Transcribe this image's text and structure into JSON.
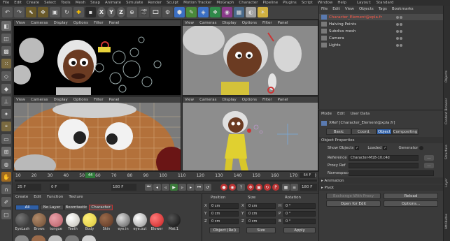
{
  "menubar": {
    "items": [
      "File",
      "Edit",
      "Create",
      "Select",
      "Tools",
      "Mesh",
      "Snap",
      "Animate",
      "Simulate",
      "Render",
      "Sculpt",
      "Motion Tracker",
      "MoGraph",
      "Character",
      "Pipeline",
      "Plugins",
      "Script",
      "Window",
      "Help"
    ],
    "right_text": "Layout:",
    "right_value": "Standard"
  },
  "toolbar": {
    "x": "X",
    "y": "Y",
    "z": "Z"
  },
  "viewports": {
    "top_left": {
      "menu": [
        "View",
        "Cameras",
        "Display",
        "Options",
        "Filter",
        "Panel"
      ]
    },
    "top_right": {
      "menu": [
        "View",
        "Cameras",
        "Display",
        "Options",
        "Filter",
        "Panel"
      ]
    },
    "bottom_left": {
      "menu": [
        "View",
        "Cameras",
        "Display",
        "Options",
        "Filter",
        "Panel"
      ]
    },
    "bottom_right": {
      "menu": [
        "View",
        "Cameras",
        "Display",
        "Options",
        "Filter",
        "Panel"
      ]
    }
  },
  "timeline": {
    "ticks": [
      "10",
      "20",
      "30",
      "40",
      "50",
      "60",
      "70",
      "80",
      "90",
      "100",
      "110",
      "120",
      "130",
      "140",
      "150",
      "160",
      "170",
      "180"
    ],
    "current_frame": "44",
    "frame_badge": "64 F",
    "start": "25 F",
    "preview_start": "0 F",
    "preview_end": "180 F",
    "end": "180 F"
  },
  "material_manager": {
    "menu": [
      "Create",
      "Edit",
      "Function",
      "Texture"
    ],
    "filters": [
      "All",
      "No Layer",
      "Boomtastic",
      "Character"
    ],
    "materials": [
      {
        "label": "EyeLash",
        "color": "#2a2a2a"
      },
      {
        "label": "Brows",
        "color": "#6b4a32"
      },
      {
        "label": "tongue",
        "color": "#b45a62"
      },
      {
        "label": "Teeth",
        "color": "#e8e6df"
      },
      {
        "label": "Body",
        "color": "#d9c53a"
      },
      {
        "label": "Skin",
        "color": "#5a3422"
      },
      {
        "label": "eye.in",
        "color": "#8a8a8a"
      },
      {
        "label": "eye.out",
        "color": "#bdbdbd"
      },
      {
        "label": "Blower",
        "color": "#c81f1f"
      },
      {
        "label": "Mat.1",
        "color": "#0e0e0e"
      }
    ]
  },
  "coord_manager": {
    "headers": [
      "Position",
      "Size",
      "Rotation"
    ],
    "rows": [
      {
        "axis": "X",
        "pos": "0 cm",
        "sizeaxis": "X",
        "size": "0 cm",
        "rotaxis": "H",
        "rot": "0 °"
      },
      {
        "axis": "Y",
        "pos": "0 cm",
        "sizeaxis": "Y",
        "size": "0 cm",
        "rotaxis": "P",
        "rot": "0 °"
      },
      {
        "axis": "Z",
        "pos": "0 cm",
        "sizeaxis": "Z",
        "size": "0 cm",
        "rotaxis": "B",
        "rot": "0 °"
      }
    ],
    "mode_select": "Object (Rel)",
    "size_select": "Size",
    "apply": "Apply"
  },
  "object_manager": {
    "menu": [
      "File",
      "Edit",
      "View",
      "Objects",
      "Tags",
      "Bookmarks"
    ],
    "objects": [
      {
        "name": "Character_Element@xpla.fr",
        "selected": true,
        "red": true
      },
      {
        "name": "Halving Points",
        "selected": false,
        "red": false
      },
      {
        "name": "Subdivs mesh",
        "selected": false,
        "red": false
      },
      {
        "name": "Camera",
        "selected": false,
        "red": false
      },
      {
        "name": "Lights",
        "selected": false,
        "red": false
      }
    ]
  },
  "attributes": {
    "menu": [
      "Mode",
      "Edit",
      "User Data"
    ],
    "object_title": "XRef [Character_Element@xpla.fr]",
    "tabs": [
      "Basic",
      "Coord.",
      "Object",
      "Compositing"
    ],
    "active_tab": "Object",
    "section": "Object Properties",
    "show_objects_label": "Show Objects",
    "loaded_label": "Loaded",
    "generator_label": "Generator",
    "reference_label": "Reference",
    "reference_value": "Character-M18-10.c4d",
    "proxy_label": "Proxy Ref",
    "namespace_label": "Namespace",
    "animation_label": "Animation",
    "pivot_label": "Pivot",
    "exchange_btn": "Exchange With Proxy",
    "reload_btn": "Reload",
    "open_btn": "Open for Edit",
    "options_btn": "Options..."
  },
  "right_rail": [
    "Attributes",
    "Layer",
    "Structure",
    "Content Browser",
    "Objects"
  ]
}
